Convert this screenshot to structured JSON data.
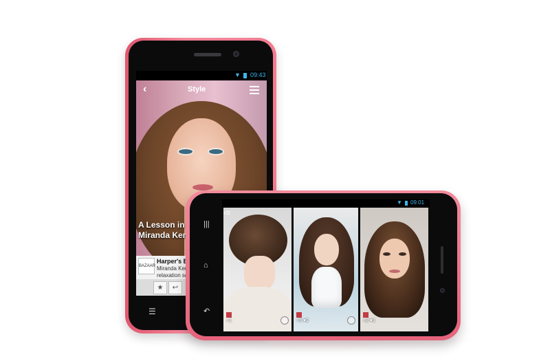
{
  "phone_portrait": {
    "status_time": "09:43",
    "app_title": "Style",
    "headline_line1": "A Lesson in Re",
    "headline_line2": "Miranda Kerr",
    "source_logo": "BAZAAR",
    "source_name": "Harper's Bazaa",
    "source_line1": "Miranda Kerr's",
    "source_line2": "relaxation secre"
  },
  "phone_landscape": {
    "status_time": "09:01",
    "tiles": [
      {
        "stats_line2": "+1"
      },
      {
        "stats_line2": "+5 ♥2"
      },
      {
        "stats_line2": "+2 ♥1"
      }
    ]
  },
  "colors": {
    "phone_body": "#f27b90",
    "screen_bezel": "#0b0b0c",
    "status_accent": "#3fb5e8"
  }
}
